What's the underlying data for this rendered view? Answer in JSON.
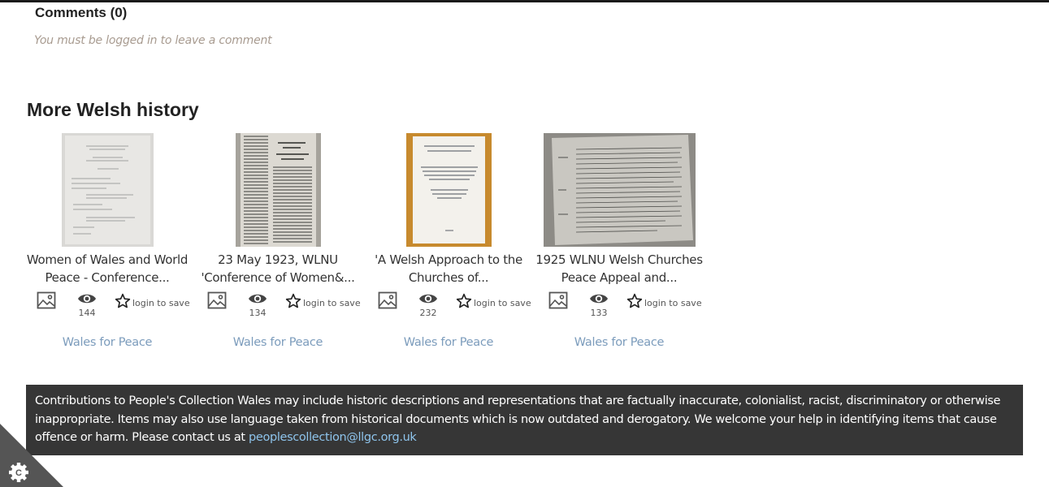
{
  "comments": {
    "title": "Comments (0)",
    "login_note": "You must be logged in to leave a comment"
  },
  "section": {
    "title": "More Welsh history"
  },
  "cards": [
    {
      "title_line1": "Women of Wales and World",
      "title_line2": "Peace - Conference...",
      "views": "144",
      "save_label": "login to save",
      "collection": "Wales for Peace",
      "media_icon": "image-icon"
    },
    {
      "title_line1": "23 May 1923, WLNU",
      "title_line2": "'Conference of Women&...",
      "views": "134",
      "save_label": "login to save",
      "collection": "Wales for Peace",
      "media_icon": "image-icon"
    },
    {
      "title_line1": "'A Welsh Approach to the",
      "title_line2": "Churches of...",
      "views": "232",
      "save_label": "login to save",
      "collection": "Wales for Peace",
      "media_icon": "image-icon"
    },
    {
      "title_line1": "1925 WLNU Welsh Churches",
      "title_line2": "Peace Appeal and...",
      "views": "133",
      "save_label": "login to save",
      "collection": "Wales for Peace",
      "media_icon": "image-icon"
    }
  ],
  "disclaimer": {
    "text": "Contributions to People's Collection Wales may include historic descriptions and representations that are factually inaccurate, colonialist, racist, discriminatory or otherwise inappropriate. Items may also use language taken from historical documents which is now outdated and derogatory. We welcome your help in identifying items that cause offence or harm. Please contact us at ",
    "email": "peoplescollection@llgc.org.uk"
  },
  "colors": {
    "link": "#7c9cbc",
    "disclaimer_bg": "#363636",
    "email_link": "#8ec4ec",
    "muted_note": "#a89b90"
  },
  "icons": {
    "views": "eye-icon",
    "save": "star-outline-icon",
    "cookie": "cookie-settings-gear-icon"
  }
}
